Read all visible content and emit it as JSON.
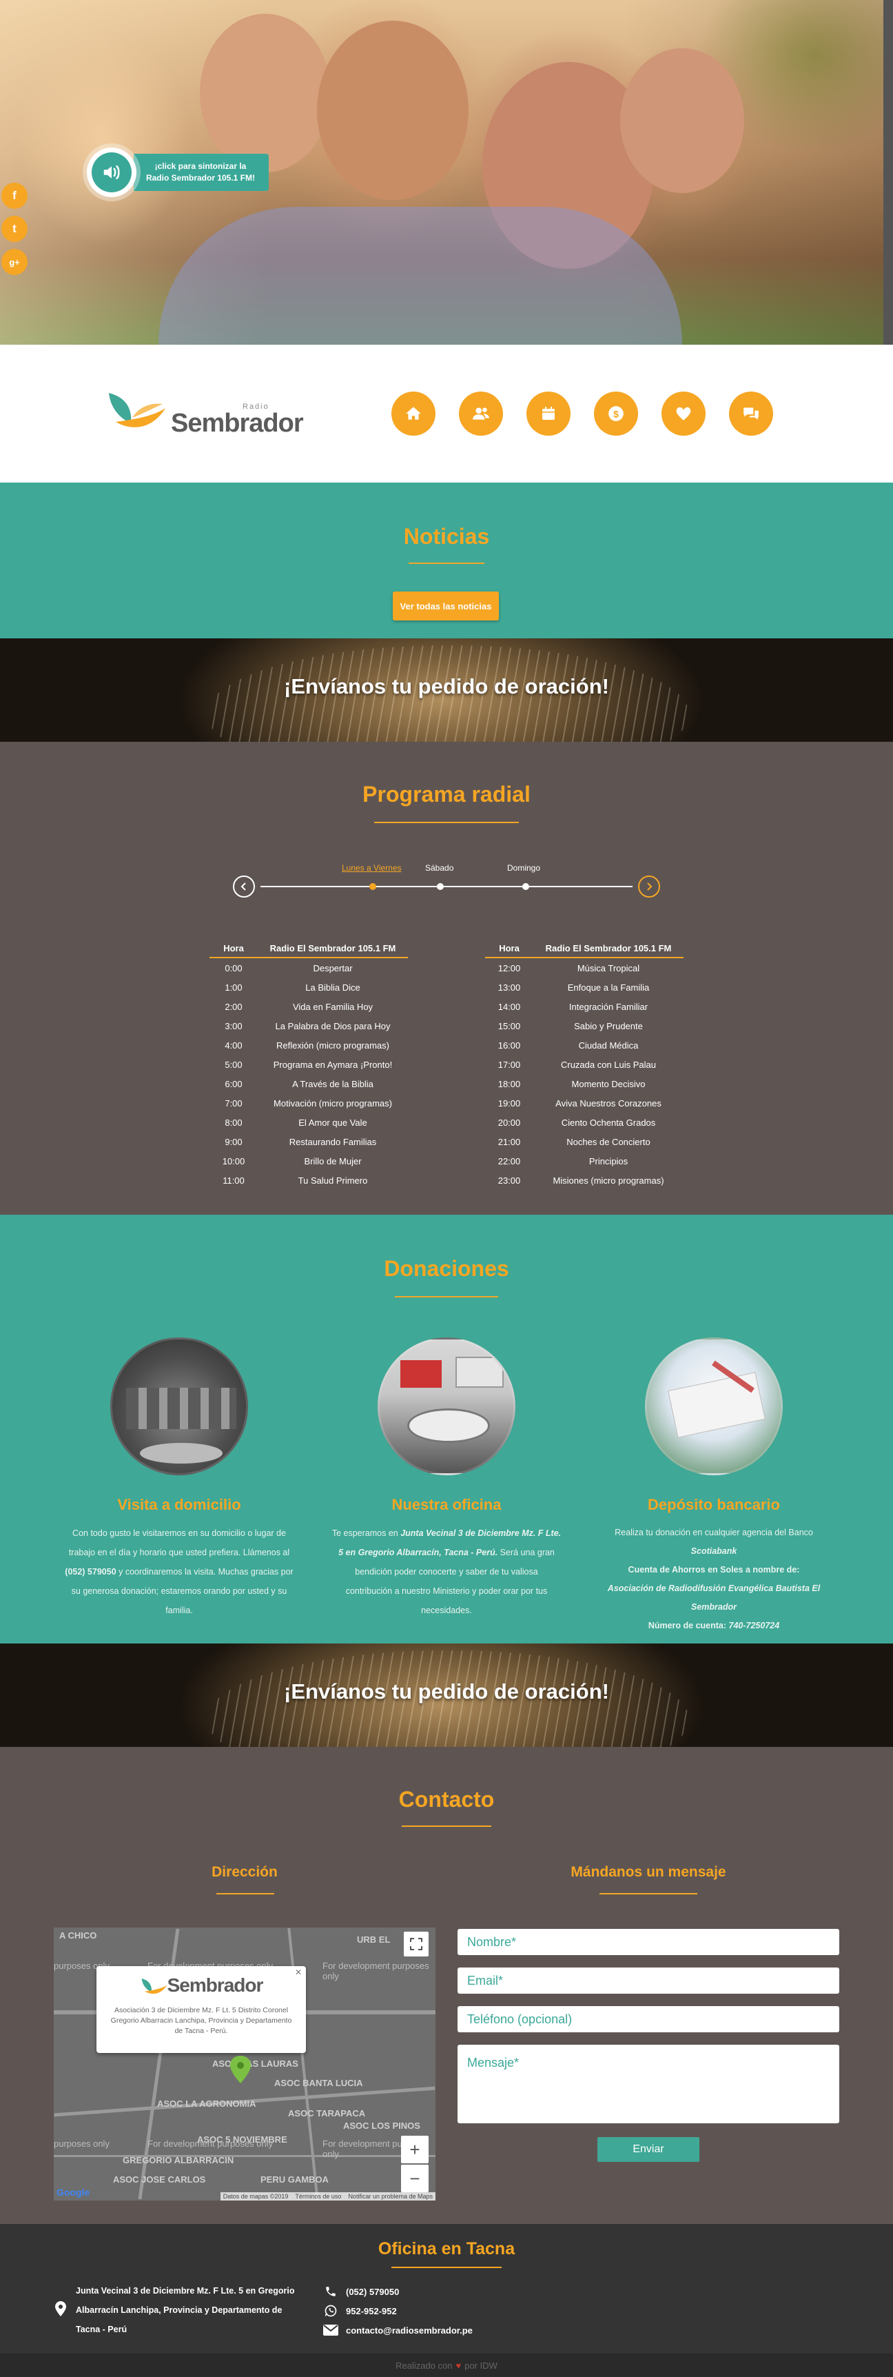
{
  "hero": {
    "radio_label": "¡click para sintonizar la Radio Sembrador 105.1 FM!",
    "social": [
      {
        "label": "f",
        "icon": "facebook-icon"
      },
      {
        "label": "t",
        "icon": "twitter-icon"
      },
      {
        "label": "g+",
        "icon": "google-plus-icon"
      }
    ]
  },
  "brand": {
    "radio": "Radio",
    "name": "Sembrador"
  },
  "nav": [
    {
      "icon": "home-icon"
    },
    {
      "icon": "users-icon"
    },
    {
      "icon": "calendar-icon"
    },
    {
      "icon": "coin-icon"
    },
    {
      "icon": "heart-icon"
    },
    {
      "icon": "chat-icon"
    }
  ],
  "news": {
    "title": "Noticias",
    "button": "Ver todas las noticias"
  },
  "prayer_banner": "¡Envíanos tu pedido de oración!",
  "radio_program": {
    "title": "Programa radial",
    "tabs": [
      "Lunes a Viernes",
      "Sábado",
      "Domingo"
    ],
    "head_hour": "Hora",
    "head_station": "Radio El Sembrador 105.1 FM",
    "left": [
      [
        "0:00",
        "Despertar"
      ],
      [
        "1:00",
        "La Biblia Dice"
      ],
      [
        "2:00",
        "Vida en Familia Hoy"
      ],
      [
        "3:00",
        "La Palabra de Dios para Hoy"
      ],
      [
        "4:00",
        "Reflexión (micro programas)"
      ],
      [
        "5:00",
        "Programa en Aymara ¡Pronto!"
      ],
      [
        "6:00",
        "A Través de la Biblia"
      ],
      [
        "7:00",
        "Motivación (micro programas)"
      ],
      [
        "8:00",
        "El Amor que Vale"
      ],
      [
        "9:00",
        "Restaurando Familias"
      ],
      [
        "10:00",
        "Brillo de Mujer"
      ],
      [
        "11:00",
        "Tu Salud Primero"
      ]
    ],
    "right": [
      [
        "12:00",
        "Música Tropical"
      ],
      [
        "13:00",
        "Enfoque a la Familia"
      ],
      [
        "14:00",
        "Integración Familiar"
      ],
      [
        "15:00",
        "Sabio y Prudente"
      ],
      [
        "16:00",
        "Ciudad Médica"
      ],
      [
        "17:00",
        "Cruzada con Luis Palau"
      ],
      [
        "18:00",
        "Momento Decisivo"
      ],
      [
        "19:00",
        "Aviva Nuestros Corazones"
      ],
      [
        "20:00",
        "Ciento Ochenta Grados"
      ],
      [
        "21:00",
        "Noches de Concierto"
      ],
      [
        "22:00",
        "Principios"
      ],
      [
        "23:00",
        "Misiones (micro programas)"
      ]
    ]
  },
  "donations": {
    "title": "Donaciones",
    "cols": [
      {
        "title": "Visita a domicilio",
        "t1": "Con todo gusto le visitaremos en su domicilio o lugar de trabajo en el día y horario que usted prefiera. Llámenos al ",
        "phone": "(052) 579050",
        "t2": " y coordinaremos la visita. Muchas gracias por su generosa donación; estaremos orando por usted y su familia."
      },
      {
        "title": "Nuestra oficina",
        "t1": "Te esperamos en ",
        "addr": "Junta Vecinal 3 de Diciembre Mz. F Lte. 5 en Gregorio Albarracín, Tacna - Perú.",
        "t2": " Será una gran bendición poder conocerte y saber de tu valiosa contribución a nuestro Ministerio y poder orar por tus necesidades."
      },
      {
        "title": "Depósito bancario",
        "t1": "Realiza tu donación en cualquier agencia del Banco",
        "bank": "Scotiabank",
        "account_title": "Cuenta de Ahorros en Soles a nombre de:",
        "holder": "Asociación de Radiodifusión Evangélica Bautista El Sembrador",
        "account_label": "Número de cuenta: ",
        "account": "740-7250724"
      }
    ]
  },
  "contact": {
    "title": "Contacto",
    "address_title": "Dirección",
    "message_title": "Mándanos un mensaje",
    "map": {
      "popup_text": "Asociación 3 de Diciembre Mz. F Lt. 5 Distrito Coronel Gregorio Albarracin Lanchipa, Provincia y Departamento de Tacna - Perú.",
      "dev_text": "For development purposes only",
      "dev_text_cut": "purposes only",
      "streets": [
        "A CHICO",
        "URB EL",
        "ASOC LAS LAURAS",
        "ASOC BANTA LUCIA",
        "ASOC LA AGRONOMIA",
        "ASOC TARAPACA",
        "ASOC 5 NOVIEMBRE",
        "ASOC LOS PINOS",
        "GREGORIO ALBARRACIN",
        "ASOC JOSE CARLOS",
        "PERU GAMBOA"
      ],
      "footer": [
        "Datos de mapas ©2019",
        "Términos de uso",
        "Notificar un problema de Maps"
      ],
      "google": "Google"
    },
    "form": {
      "name": "Nombre*",
      "email": "Email*",
      "phone": "Teléfono (opcional)",
      "message": "Mensaje*",
      "send": "Enviar"
    }
  },
  "footer": {
    "title": "Oficina en Tacna",
    "address": "Junta Vecinal 3 de Diciembre Mz. F Lte. 5 en Gregorio Albarracín Lanchipa, Provincia y Departamento de Tacna - Perú",
    "phone": "(052) 579050",
    "whatsapp": "952-952-952",
    "email": "contacto@radiosembrador.pe",
    "credits_a": "Realizado con",
    "credits_b": "por IDW"
  }
}
